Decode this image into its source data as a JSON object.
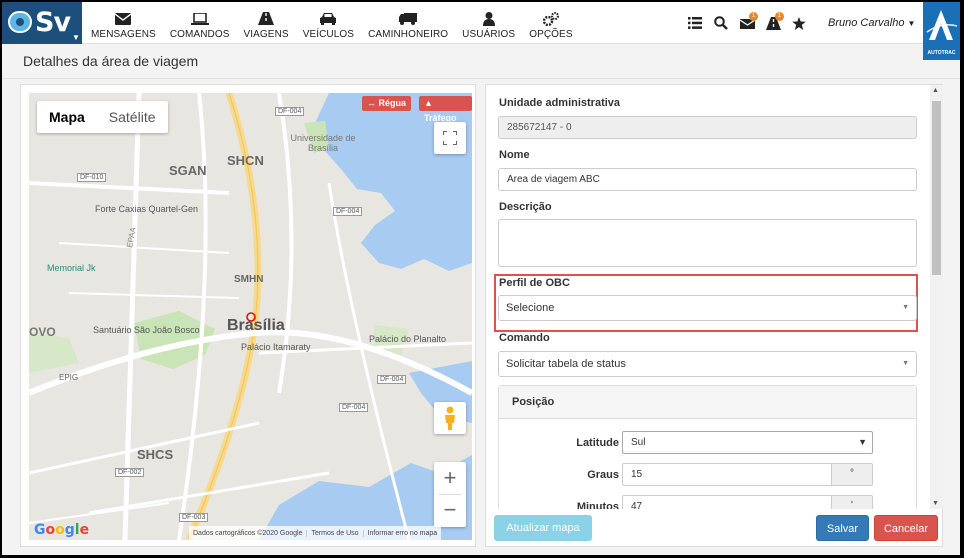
{
  "brand": {
    "logo_text": "Sv"
  },
  "nav": {
    "items": [
      {
        "label": "MENSAGENS",
        "icon": "envelope-icon"
      },
      {
        "label": "COMANDOS",
        "icon": "laptop-icon"
      },
      {
        "label": "VIAGENS",
        "icon": "road-icon"
      },
      {
        "label": "VEÍCULOS",
        "icon": "car-icon"
      },
      {
        "label": "CAMINHONEIRO",
        "icon": "truck-icon"
      },
      {
        "label": "USUÁRIOS",
        "icon": "user-icon"
      },
      {
        "label": "OPÇÕES",
        "icon": "gears-icon"
      }
    ]
  },
  "tools": {
    "messages_badge": "1",
    "alerts_badge": "1"
  },
  "user": {
    "name": "Bruno Carvalho"
  },
  "autotrac": {
    "label": "AUTOTRAC"
  },
  "page": {
    "title": "Detalhes da área de viagem"
  },
  "map": {
    "tabs": {
      "map": "Mapa",
      "satellite": "Satélite"
    },
    "chips": {
      "ruler": "Régua",
      "traffic": "Tráfego"
    },
    "labels": {
      "sgan": "SGAN",
      "shcn": "SHCN",
      "smhn": "SMHN",
      "shcs": "SHCS",
      "brasilia": "Brasília",
      "unb": "Universidade de Brasília",
      "forte": "Forte Caxias Quartel-Gen",
      "memorial": "Memorial Jk",
      "santuario": "Santuário São João Bosco",
      "itamaraty": "Palácio Itamaraty",
      "planalto": "Palácio do Planalto",
      "epaa": "EPAA",
      "epig": "EPIG",
      "ovo": "OVO",
      "df004a": "DF-004",
      "df004b": "DF-004",
      "df004c": "DF-004",
      "df004d": "DF-004",
      "df010": "DF-010",
      "df002": "DF-002",
      "df003": "DF-003"
    },
    "footer": {
      "data": "Dados cartográficos ©2020 Google",
      "terms": "Termos de Uso",
      "report": "Informar erro no mapa"
    }
  },
  "form": {
    "unit_label": "Unidade administrativa",
    "unit_value": "285672147 - 0",
    "name_label": "Nome",
    "name_value": "Area de viagem ABC",
    "desc_label": "Descrição",
    "desc_value": "",
    "obc_label": "Perfil de OBC",
    "obc_value": "Selecione",
    "cmd_label": "Comando",
    "cmd_value": "Solicitar tabela de status",
    "position_title": "Posição",
    "latitude_label": "Latitude",
    "latitude_value": "Sul",
    "graus_label": "Graus",
    "graus_value": "15",
    "graus_unit": "°",
    "minutos_label": "Minutos",
    "minutos_value": "47",
    "minutos_unit": "'"
  },
  "buttons": {
    "update_map": "Atualizar mapa",
    "save": "Salvar",
    "cancel": "Cancelar"
  }
}
